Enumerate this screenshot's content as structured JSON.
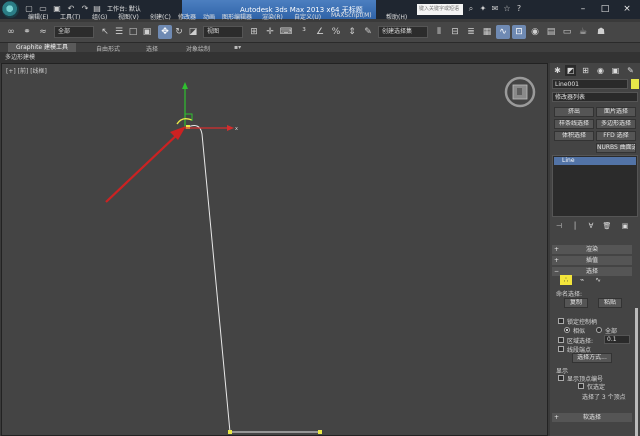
{
  "titlebar": {
    "workspace": "工作台: 默认",
    "title": "Autodesk 3ds Max 2013 x64     无标题",
    "search_placeholder": "键入关键字或短语"
  },
  "menu": [
    "编辑(E)",
    "工具(T)",
    "组(G)",
    "视图(V)",
    "创建(C)",
    "修改器",
    "动画",
    "图形编辑器",
    "渲染(R)",
    "自定义(U)",
    "MAXScript(M)",
    "帮助(H)"
  ],
  "toolbar": {
    "filter": "全部",
    "ref_coord": "视图",
    "named_sel": "创建选择集"
  },
  "ribbon": {
    "tabs": [
      "Graphite 建模工具",
      "自由形式",
      "选择",
      "对象绘制"
    ],
    "sub": "多边形建模"
  },
  "viewport": {
    "label": "[+] [前] [线框]"
  },
  "cmd_panel": {
    "object_name": "Line001",
    "modifier_list": "修改器列表",
    "buttons": [
      "挤出",
      "面片选择",
      "样条线选择",
      "多边形选择",
      "体积选择",
      "FFD 选择",
      "NURBS 曲面选择"
    ],
    "stack_item": "Line",
    "rollouts": {
      "render": "渲染",
      "interp": "插值",
      "selection": "选择",
      "soft_sel": "软选择"
    },
    "named_sel_label": "命名选择:",
    "copy": "复制",
    "paste": "粘贴",
    "lock_handles": "锁定控制柄",
    "similar": "相似",
    "all": "全部",
    "area_select": "区域选择:",
    "area_value": "0.1",
    "segment_end": "线段端点",
    "select_by": "选择方式...",
    "display_label": "显示",
    "show_vertex_numbers": "显示顶点编号",
    "only_selected": "仅选定",
    "status": "选择了 3 个顶点"
  },
  "colors": {
    "accent": "#6f8ab3",
    "title_highlight": "#3a6fb3",
    "selected_vertex_icon": "#f3e53b",
    "gizmo_y": "#2fbf2f",
    "gizmo_x": "#d42d2d",
    "arrow": "#cc2222"
  },
  "icons": {
    "app": "3dsmax-logo",
    "viewcube": "viewcube-icon"
  }
}
